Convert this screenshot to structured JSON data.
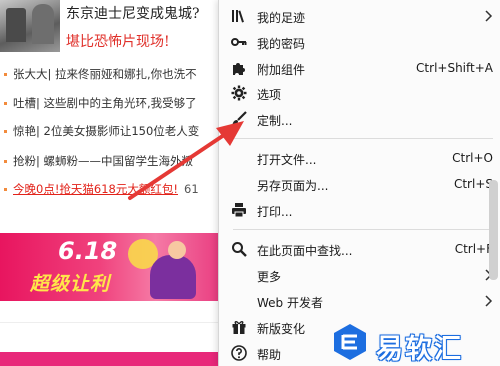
{
  "page": {
    "headline_1": "东京迪士尼变成鬼城?",
    "headline_2": "堪比恐怖片现场!",
    "news": [
      "张大大| 拉来佟丽娅和娜扎,你也洗不",
      "吐槽| 这些剧中的主角光环,我受够了",
      "惊艳| 2位美女摄影师让150位老人变",
      "抢粉| 螺蛳粉——中国留学生海外叛",
      "今晚0点!抢天猫618元大额红包!"
    ],
    "news_extra": "61",
    "banner": {
      "number": "6.18",
      "slogan": "超级让利"
    }
  },
  "menu": {
    "items": [
      {
        "label": "我的足迹",
        "shortcut": "",
        "submenu": true,
        "icon": "library-icon"
      },
      {
        "label": "我的密码",
        "shortcut": "",
        "submenu": false,
        "icon": "key-icon"
      },
      {
        "label": "附加组件",
        "shortcut": "Ctrl+Shift+A",
        "submenu": false,
        "icon": "puzzle-icon"
      },
      {
        "label": "选项",
        "shortcut": "",
        "submenu": false,
        "icon": "gear-icon"
      },
      {
        "label": "定制...",
        "shortcut": "",
        "submenu": false,
        "icon": "brush-icon"
      },
      {
        "label": "打开文件...",
        "shortcut": "Ctrl+O",
        "submenu": false,
        "icon": ""
      },
      {
        "label": "另存页面为...",
        "shortcut": "Ctrl+S",
        "submenu": false,
        "icon": ""
      },
      {
        "label": "打印...",
        "shortcut": "",
        "submenu": false,
        "icon": "printer-icon"
      },
      {
        "label": "在此页面中查找...",
        "shortcut": "Ctrl+F",
        "submenu": false,
        "icon": "search-icon"
      },
      {
        "label": "更多",
        "shortcut": "",
        "submenu": true,
        "icon": ""
      },
      {
        "label": "Web 开发者",
        "shortcut": "",
        "submenu": true,
        "icon": ""
      },
      {
        "label": "新版变化",
        "shortcut": "",
        "submenu": false,
        "icon": "gift-icon"
      },
      {
        "label": "帮助",
        "shortcut": "",
        "submenu": true,
        "icon": "help-icon"
      }
    ]
  },
  "watermark": {
    "text": "易软汇"
  },
  "colors": {
    "accent_red": "#e2231a",
    "arrow_red": "#e53935",
    "watermark_blue": "#1d6ee0"
  }
}
